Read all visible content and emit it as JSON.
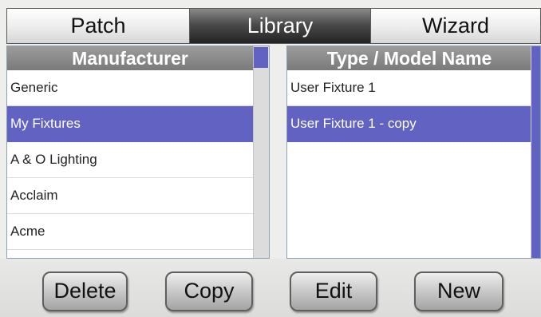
{
  "tabs": [
    {
      "label": "Patch",
      "active": false
    },
    {
      "label": "Library",
      "active": true
    },
    {
      "label": "Wizard",
      "active": false
    }
  ],
  "manufacturer_list": {
    "header": "Manufacturer",
    "items": [
      "Generic",
      "My Fixtures",
      "A & O Lighting",
      "Acclaim",
      "Acme"
    ],
    "selected_index": 1
  },
  "model_list": {
    "header": "Type / Model Name",
    "items": [
      "User Fixture 1",
      "User Fixture 1 - copy"
    ],
    "selected_index": 1
  },
  "buttons": {
    "delete": "Delete",
    "copy": "Copy",
    "edit": "Edit",
    "new": "New"
  },
  "colors": {
    "selection": "#6262c2",
    "header": "#8a8a8a",
    "active_tab": "#2e2e2e"
  }
}
